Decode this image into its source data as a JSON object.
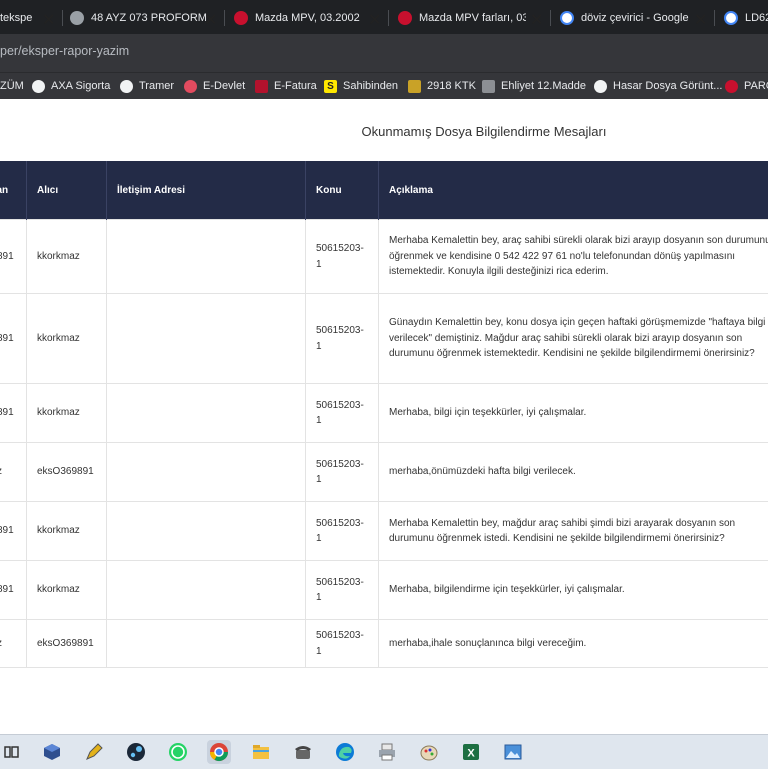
{
  "browser": {
    "tabs": [
      {
        "label": "tekspe",
        "favicon": "page-icon",
        "color": "#9aa0a6"
      },
      {
        "label": "48 AYZ 073 PROFORM",
        "favicon": "globe-icon",
        "color": "#9aa0a6"
      },
      {
        "label": "Mazda MPV, 03.2002",
        "favicon": "site-red-icon",
        "color": "#c8102e"
      },
      {
        "label": "Mazda MPV farları, 03.",
        "favicon": "site-red-icon",
        "color": "#c8102e"
      },
      {
        "label": "döviz çevirici - Google",
        "favicon": "google-icon",
        "color": "#4285f4"
      },
      {
        "label": "LD62",
        "favicon": "google-icon",
        "color": "#4285f4"
      }
    ],
    "url": "per/eksper-rapor-yazim",
    "bookmarks": [
      {
        "label": "ZÜM",
        "icon": "none"
      },
      {
        "label": "AXA Sigorta",
        "icon": "globe-icon"
      },
      {
        "label": "Tramer",
        "icon": "globe-icon"
      },
      {
        "label": "E-Devlet",
        "icon": "edevlet-icon"
      },
      {
        "label": "E-Fatura",
        "icon": "efatura-icon"
      },
      {
        "label": "Sahibinden",
        "icon": "sahibinden-icon"
      },
      {
        "label": "2918 KTK",
        "icon": "law-icon"
      },
      {
        "label": "Ehliyet 12.Madde",
        "icon": "license-icon"
      },
      {
        "label": "Hasar Dosya Görünt...",
        "icon": "globe-icon"
      },
      {
        "label": "PARÇ",
        "icon": "site-red-icon"
      }
    ]
  },
  "page": {
    "title": "Okunmamış Dosya Bilgilendirme Mesajları"
  },
  "table": {
    "headers": {
      "sender": "an",
      "receiver": "Alıcı",
      "contact": "İletişim Adresi",
      "subject": "Konu",
      "description": "Açıklama"
    },
    "rows": [
      {
        "sender": "891",
        "receiver": "kkorkmaz",
        "contact": "",
        "subject": "50615203-\n1",
        "description": "Merhaba Kemalettin bey, araç sahibi sürekli olarak bizi arayıp dosyanın son durumunu öğrenmek ve kendisine 0 542 422 97 61 no'lu telefonundan dönüş yapılmasını istemektedir. Konuyla ilgili desteğinizi rica ederim."
      },
      {
        "sender": "891",
        "receiver": "kkorkmaz",
        "contact": "",
        "subject": "50615203-\n1",
        "description": "Günaydın Kemalettin bey, konu dosya için geçen haftaki görüşmemizde \"haftaya bilgi verilecek\" demiştiniz. Mağdur araç sahibi sürekli olarak bizi arayıp dosyanın son durumunu öğrenmek istemektedir. Kendisini ne şekilde bilgilendirmemi önerirsiniz?"
      },
      {
        "sender": "891",
        "receiver": "kkorkmaz",
        "contact": "",
        "subject": "50615203-\n1",
        "description": "Merhaba, bilgi için teşekkürler, iyi çalışmalar."
      },
      {
        "sender": "z",
        "receiver": "eksO369891",
        "contact": "",
        "subject": "50615203-\n1",
        "description": "merhaba,önümüzdeki hafta bilgi verilecek."
      },
      {
        "sender": "891",
        "receiver": "kkorkmaz",
        "contact": "",
        "subject": "50615203-\n1",
        "description": "Merhaba Kemalettin bey, mağdur araç sahibi şimdi bizi arayarak dosyanın son durumunu öğrenmek istedi. Kendisini ne şekilde bilgilendirmemi önerirsiniz?"
      },
      {
        "sender": "891",
        "receiver": "kkorkmaz",
        "contact": "",
        "subject": "50615203-\n1",
        "description": "Merhaba, bilgilendirme için teşekkürler, iyi çalışmalar."
      },
      {
        "sender": "z",
        "receiver": "eksO369891",
        "contact": "",
        "subject": "50615203-\n1",
        "description": "merhaba,ihale sonuçlanınca bilgi vereceğim."
      }
    ]
  },
  "taskbar": {
    "items": [
      {
        "icon": "task-view-icon",
        "active": false
      },
      {
        "icon": "app-cube-icon",
        "active": false
      },
      {
        "icon": "pen-tool-icon",
        "active": false
      },
      {
        "icon": "steam-icon",
        "active": false
      },
      {
        "icon": "whatsapp-icon",
        "active": false
      },
      {
        "icon": "chrome-icon",
        "active": true
      },
      {
        "icon": "file-explorer-icon",
        "active": false
      },
      {
        "icon": "phone-icon",
        "active": false
      },
      {
        "icon": "edge-icon",
        "active": false
      },
      {
        "icon": "printer-icon",
        "active": false
      },
      {
        "icon": "paint-icon",
        "active": false
      },
      {
        "icon": "excel-icon",
        "active": false
      },
      {
        "icon": "photos-icon",
        "active": false
      }
    ]
  },
  "colors": {
    "table_header_bg": "#232b47",
    "tabbar_bg": "#1f2124",
    "toolbar_bg": "#35363a",
    "taskbar_bg": "#dfe6ee"
  }
}
